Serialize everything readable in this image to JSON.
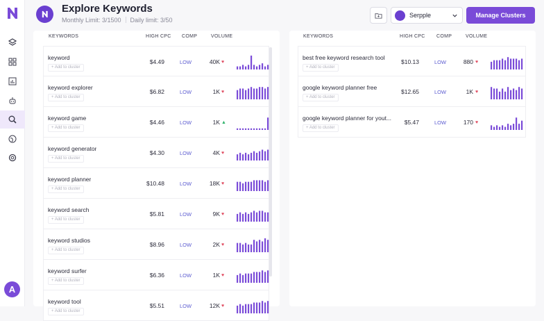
{
  "header": {
    "title": "Explore Keywords",
    "monthly_limit": "Monthly Limit: 3/1500",
    "daily_limit": "Daily limit: 3/50",
    "project_select": "Serpple",
    "manage_clusters": "Manage Clusters"
  },
  "user": {
    "avatar_initial": "A"
  },
  "columns": {
    "keywords": "KEYWORDS",
    "cpc": "HIGH CPC",
    "comp": "COMP",
    "volume": "VOLUME"
  },
  "add_label": "+ Add to cluster",
  "colors": {
    "accent": "#7a4bd8",
    "low": "#5b5bd0",
    "down": "#e04e63",
    "up": "#2fb36b"
  },
  "icons": [
    "logo-icon",
    "layers-icon",
    "grid-icon",
    "chart-icon",
    "bot-icon",
    "search-icon",
    "globe-icon",
    "settings-icon",
    "folder-icon",
    "chevron-down-icon"
  ],
  "left_rows": [
    {
      "keyword": "keyword",
      "cpc": "$4.49",
      "comp": "LOW",
      "volume": "40K",
      "trend": "down",
      "spark": [
        2,
        2,
        3,
        2,
        3,
        9,
        3,
        2,
        3,
        4,
        2,
        3
      ]
    },
    {
      "keyword": "keyword explorer",
      "cpc": "$6.82",
      "comp": "LOW",
      "volume": "1K",
      "trend": "down",
      "spark": [
        6,
        7,
        7,
        6,
        7,
        8,
        7,
        7,
        8,
        8,
        7,
        8
      ]
    },
    {
      "keyword": "keyword game",
      "cpc": "$4.46",
      "comp": "LOW",
      "volume": "1K",
      "trend": "up",
      "spark": [
        1,
        1,
        1,
        1,
        1,
        1,
        1,
        1,
        1,
        1,
        1,
        8
      ]
    },
    {
      "keyword": "keyword generator",
      "cpc": "$4.30",
      "comp": "LOW",
      "volume": "4K",
      "trend": "down",
      "spark": [
        4,
        5,
        4,
        5,
        4,
        5,
        6,
        5,
        6,
        7,
        6,
        7
      ]
    },
    {
      "keyword": "keyword planner",
      "cpc": "$10.48",
      "comp": "LOW",
      "volume": "18K",
      "trend": "down",
      "spark": [
        6,
        6,
        5,
        6,
        6,
        6,
        7,
        7,
        7,
        7,
        6,
        7
      ]
    },
    {
      "keyword": "keyword search",
      "cpc": "$5.81",
      "comp": "LOW",
      "volume": "9K",
      "trend": "down",
      "spark": [
        5,
        6,
        5,
        6,
        5,
        6,
        7,
        6,
        7,
        7,
        6,
        6
      ]
    },
    {
      "keyword": "keyword studios",
      "cpc": "$8.96",
      "comp": "LOW",
      "volume": "2K",
      "trend": "down",
      "spark": [
        6,
        6,
        5,
        6,
        5,
        5,
        8,
        7,
        8,
        7,
        9,
        8
      ]
    },
    {
      "keyword": "keyword surfer",
      "cpc": "$6.36",
      "comp": "LOW",
      "volume": "1K",
      "trend": "down",
      "spark": [
        5,
        6,
        5,
        6,
        6,
        6,
        7,
        7,
        7,
        8,
        7,
        8
      ]
    },
    {
      "keyword": "keyword tool",
      "cpc": "$5.51",
      "comp": "LOW",
      "volume": "12K",
      "trend": "down",
      "spark": [
        5,
        6,
        5,
        6,
        6,
        6,
        7,
        7,
        7,
        8,
        7,
        8
      ]
    }
  ],
  "right_rows": [
    {
      "keyword": "best free keyword research tool",
      "cpc": "$10.13",
      "comp": "LOW",
      "volume": "880",
      "trend": "down",
      "spark": [
        5,
        6,
        6,
        6,
        7,
        6,
        8,
        7,
        7,
        7,
        6,
        7
      ]
    },
    {
      "keyword": "google keyword planner free",
      "cpc": "$12.65",
      "comp": "LOW",
      "volume": "1K",
      "trend": "down",
      "spark": [
        8,
        7,
        7,
        5,
        7,
        5,
        8,
        6,
        7,
        6,
        8,
        7
      ]
    },
    {
      "keyword": "google keyword planner for yout...",
      "cpc": "$5.47",
      "comp": "LOW",
      "volume": "170",
      "trend": "down",
      "spark": [
        3,
        2,
        3,
        2,
        3,
        2,
        4,
        3,
        4,
        8,
        4,
        6
      ]
    }
  ]
}
